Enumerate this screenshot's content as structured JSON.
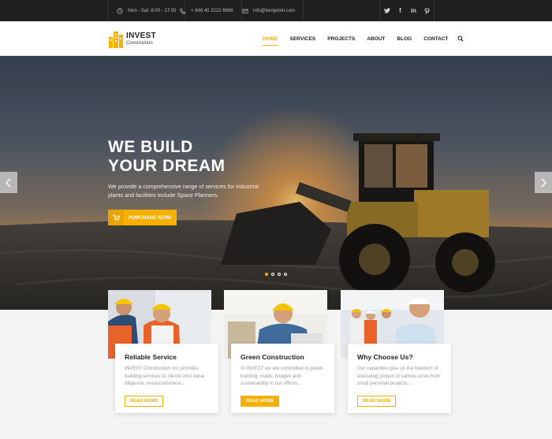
{
  "topbar": {
    "hours": "Mon - Sat: 8:00 - 17:00",
    "phone": "+ 846 40 2222 6666",
    "email": "info@benjamin.com",
    "social": [
      "twitter-icon",
      "facebook-icon",
      "linkedin-icon",
      "pinterest-icon"
    ]
  },
  "header": {
    "logo_name": "INVEST",
    "logo_sub": "Construction",
    "nav": [
      "HOME",
      "SERVICES",
      "PROJECTS",
      "ABOUT",
      "BLOG",
      "CONTACT"
    ],
    "active_nav": "HOME"
  },
  "hero": {
    "title_line1": "WE BUILD",
    "title_line2": "YOUR DREAM",
    "description": "We provide a comprehensive range of services for industrial plants and facilities include Space Planners.",
    "cta_label": "PURCHASE NOW!",
    "slide_count": 4,
    "active_slide": 1
  },
  "features": [
    {
      "title": "Reliable Service",
      "text": "INVEST Construction Inc provides building services to clients who value diligence, resourcefulness...",
      "button": "READ MORE"
    },
    {
      "title": "Green Construction",
      "text": "In INVEST we are committed to green building, roads, bridges and sustainability in our offices...",
      "button": "READ MORE"
    },
    {
      "title": "Why Choose Us?",
      "text": "Our capacities give us the freedom of executing project of various sizes from small personal projects...",
      "button": "READ MORE"
    }
  ],
  "colors": {
    "accent": "#f5b000",
    "topbar": "#1f1f1f"
  }
}
